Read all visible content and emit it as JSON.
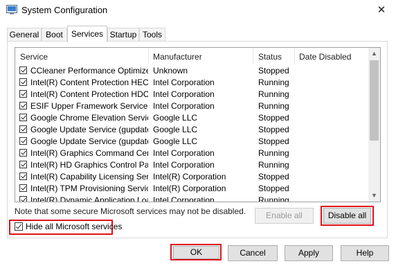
{
  "window": {
    "title": "System Configuration",
    "close_glyph": "✕",
    "icon": "system-config-icon"
  },
  "tabs": [
    {
      "label": "General"
    },
    {
      "label": "Boot"
    },
    {
      "label": "Services",
      "active": true
    },
    {
      "label": "Startup"
    },
    {
      "label": "Tools"
    }
  ],
  "table": {
    "columns": [
      "Service",
      "Manufacturer",
      "Status",
      "Date Disabled"
    ],
    "rows": [
      {
        "service": "CCleaner Performance Optimizer...",
        "manufacturer": "Unknown",
        "status": "Stopped",
        "checked": true
      },
      {
        "service": "Intel(R) Content Protection HEC...",
        "manufacturer": "Intel Corporation",
        "status": "Running",
        "checked": true
      },
      {
        "service": "Intel(R) Content Protection HDC...",
        "manufacturer": "Intel Corporation",
        "status": "Running",
        "checked": true
      },
      {
        "service": "ESIF Upper Framework Service",
        "manufacturer": "Intel Corporation",
        "status": "Running",
        "checked": true
      },
      {
        "service": "Google Chrome Elevation Servic...",
        "manufacturer": "Google LLC",
        "status": "Stopped",
        "checked": true
      },
      {
        "service": "Google Update Service (gupdate)",
        "manufacturer": "Google LLC",
        "status": "Stopped",
        "checked": true
      },
      {
        "service": "Google Update Service (gupdatem)",
        "manufacturer": "Google LLC",
        "status": "Stopped",
        "checked": true
      },
      {
        "service": "Intel(R) Graphics Command Cen...",
        "manufacturer": "Intel Corporation",
        "status": "Running",
        "checked": true
      },
      {
        "service": "Intel(R) HD Graphics Control Pa...",
        "manufacturer": "Intel Corporation",
        "status": "Running",
        "checked": true
      },
      {
        "service": "Intel(R) Capability Licensing Ser...",
        "manufacturer": "Intel(R) Corporation",
        "status": "Stopped",
        "checked": true
      },
      {
        "service": "Intel(R) TPM Provisioning Service",
        "manufacturer": "Intel(R) Corporation",
        "status": "Stopped",
        "checked": true
      },
      {
        "service": "Intel(R) Dynamic Application Loa...",
        "manufacturer": "Intel Corporation",
        "status": "Running",
        "checked": true
      }
    ]
  },
  "scrollbar": {
    "up_glyph": "▲",
    "down_glyph": "▼"
  },
  "note": "Note that some secure Microsoft services may not be disabled.",
  "buttons": {
    "enable_all": "Enable all",
    "disable_all": "Disable all",
    "ok": "OK",
    "cancel": "Cancel",
    "apply": "Apply",
    "help": "Help"
  },
  "hide_ms": {
    "label": "Hide all Microsoft services",
    "checked": true
  },
  "colors": {
    "highlight": "#e0131a",
    "thumb": "#c2c2c2"
  }
}
